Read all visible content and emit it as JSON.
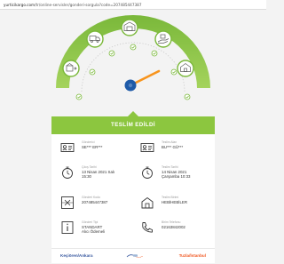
{
  "browser": {
    "url_domain": "yurticikargo.com",
    "url_path": "/tr/online-servisler/gonderi-sorgula?code=207485447387"
  },
  "tracker": {
    "accent": "#8cc63f",
    "needle_color": "#f7941d",
    "hub_color": "#1e5aa8",
    "completed_steps": 5,
    "total_steps": 5
  },
  "status": {
    "title": "TESLİM EDİLDİ"
  },
  "details": {
    "sender_label": "Gönderici",
    "sender_value": "SE*** ER***",
    "recipient_label": "Teslim Alan",
    "recipient_value": "BU*** GÜ***",
    "departure_label": "Çıkış Tarihi",
    "departure_value_1": "13 Nisan 2021 Salı",
    "departure_value_2": "15:30",
    "delivery_label": "Teslim Tarihi",
    "delivery_value_1": "14 Nisan 2021",
    "delivery_value_2": "Çarşamba 10:33",
    "code_label": "Gönderi Kodu",
    "code_value": "207485447387",
    "unit_label": "Teslim Birimi",
    "unit_value": "HEBİHEBİLER",
    "type_label": "Gönderi Tipi",
    "type_value_1": "STANDART",
    "type_value_2": "Alıcı Ödemeli",
    "phone_label": "Birim Telefonu",
    "phone_value": "02163842002"
  },
  "route": {
    "from": "Keçiören/Ankara",
    "to": "Tuzla/İstanbul",
    "from_color": "#3a5aa0",
    "to_color": "#f15a24"
  },
  "icons": [
    "box-inbound-icon",
    "truck-icon",
    "warehouse-icon",
    "hand-delivery-icon",
    "house-delivered-icon",
    "sender-card-icon",
    "receiver-card-icon",
    "stopwatch-icon",
    "clock-icon",
    "barcode-icon",
    "branch-icon",
    "info-icon",
    "phone-icon",
    "car-route-icon"
  ]
}
